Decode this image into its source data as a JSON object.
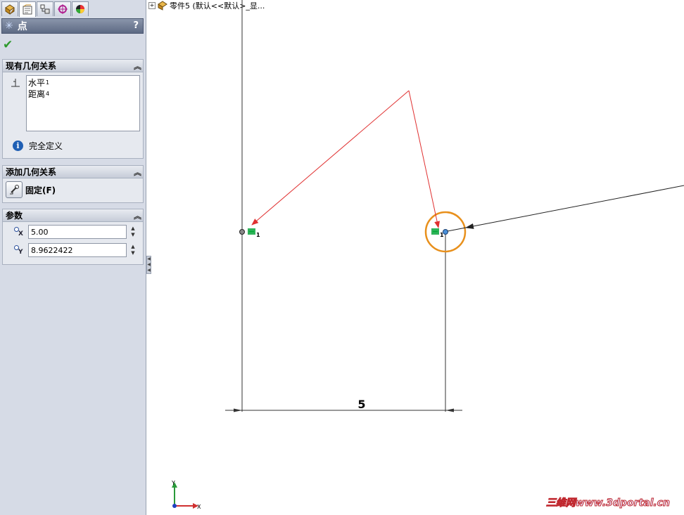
{
  "tree": {
    "root_label": "零件5 (默认<<默认>_显..."
  },
  "property_manager": {
    "title": "点",
    "help_label": "?",
    "ok_icon": "checkmark-icon",
    "groups": {
      "existing_relations": {
        "header": "现有几何关系",
        "items": [
          {
            "label": "水平",
            "index": "1"
          },
          {
            "label": "距离",
            "index": "4"
          }
        ],
        "status": "完全定义"
      },
      "add_relations": {
        "header": "添加几何关系",
        "fix_label": "固定(F)"
      },
      "parameters": {
        "header": "参数",
        "x": {
          "axis": "X",
          "value": "5.00"
        },
        "y": {
          "axis": "Y",
          "value": "8.9622422"
        }
      }
    }
  },
  "sketch": {
    "dimension_label": "5",
    "relation_index": "1",
    "triad": {
      "x": "X",
      "y": "Y"
    }
  },
  "watermark": "三维网www.3dportal.cn",
  "colors": {
    "annotation_arrow": "#e03030",
    "highlight_circle": "#e8901c",
    "relation_icon": "#2fb35a",
    "selected_point": "#4a90d9"
  }
}
